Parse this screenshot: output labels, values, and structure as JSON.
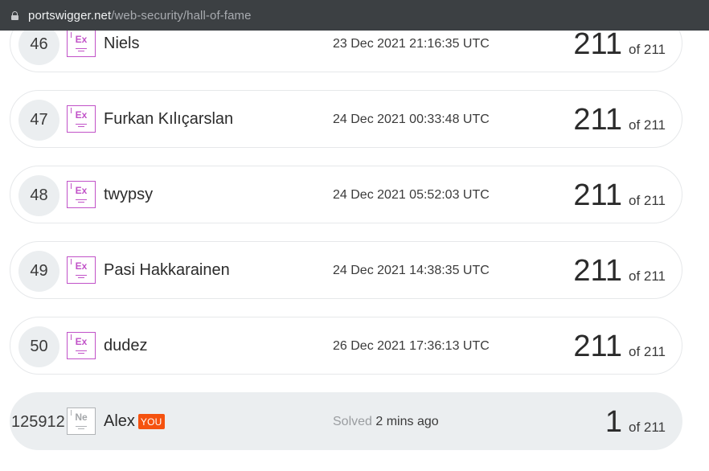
{
  "browser": {
    "domain": "portswigger.net",
    "path": "/web-security/hall-of-fame"
  },
  "leaderboard": {
    "rows": [
      {
        "rank": "46",
        "badge": "Ex",
        "name": "Niels",
        "date": "23 Dec 2021 21:16:35 UTC",
        "score": "211",
        "total": "of 211"
      },
      {
        "rank": "47",
        "badge": "Ex",
        "name": "Furkan Kılıçarslan",
        "date": "24 Dec 2021 00:33:48 UTC",
        "score": "211",
        "total": "of 211"
      },
      {
        "rank": "48",
        "badge": "Ex",
        "name": "twypsy",
        "date": "24 Dec 2021 05:52:03 UTC",
        "score": "211",
        "total": "of 211"
      },
      {
        "rank": "49",
        "badge": "Ex",
        "name": "Pasi Hakkarainen",
        "date": "24 Dec 2021 14:38:35 UTC",
        "score": "211",
        "total": "of 211"
      },
      {
        "rank": "50",
        "badge": "Ex",
        "name": "dudez",
        "date": "26 Dec 2021 17:36:13 UTC",
        "score": "211",
        "total": "of 211"
      }
    ],
    "current_user": {
      "rank": "125912",
      "badge": "Ne",
      "name": "Alex",
      "you_label": "YOU",
      "solved_label": "Solved",
      "solved_time": "2 mins ago",
      "score": "1",
      "total": "of 211"
    }
  },
  "colors": {
    "expert_badge": "#c152c8",
    "novice_badge": "#b0b3b6",
    "you_tag": "#f5520f",
    "highlight_row": "#ebeef0"
  }
}
